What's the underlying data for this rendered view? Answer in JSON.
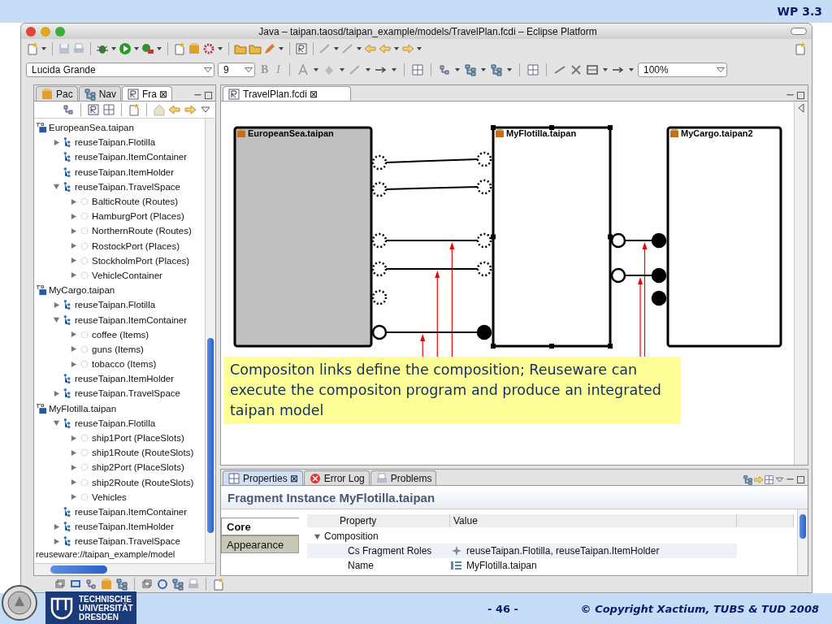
{
  "slide": {
    "section": "WP 3.3",
    "page": "- 46 -",
    "copyright": "© Copyright Xactium, TUBS & TUD 2008",
    "logo_lines": [
      "TECHNISCHE",
      "UNIVERSITÄT",
      "DRESDEN"
    ]
  },
  "window": {
    "title": "Java – taipan.taosd/taipan_example/models/TravelPlan.fcdi – Eclipse Platform"
  },
  "format_bar": {
    "font": "Lucida Grande",
    "size": "9",
    "bold": "B",
    "italic": "I",
    "zoom": "100%"
  },
  "left_panel": {
    "tabs": [
      {
        "label": "Pac",
        "selected": false
      },
      {
        "label": "Nav",
        "selected": false
      },
      {
        "label": "Fra",
        "selected": true,
        "close": "⊠"
      }
    ],
    "tree": [
      {
        "label": "EuropeanSea.taipan",
        "kind": "file",
        "children": [
          {
            "label": "reuseTaipan.Flotilla",
            "kind": "role",
            "expanded": false
          },
          {
            "label": "reuseTaipan.ItemContainer",
            "kind": "role"
          },
          {
            "label": "reuseTaipan.ItemHolder",
            "kind": "role"
          },
          {
            "label": "reuseTaipan.TravelSpace",
            "kind": "role",
            "expanded": true,
            "children": [
              {
                "label": "BalticRoute (Routes)",
                "kind": "slot",
                "expanded": false
              },
              {
                "label": "HamburgPort (Places)",
                "kind": "slot",
                "expanded": false
              },
              {
                "label": "NorthernRoute (Routes)",
                "kind": "slot",
                "expanded": false
              },
              {
                "label": "RostockPort (Places)",
                "kind": "slot",
                "expanded": false
              },
              {
                "label": "StockholmPort (Places)",
                "kind": "slot",
                "expanded": false
              },
              {
                "label": "VehicleContainer",
                "kind": "slot",
                "expanded": false
              }
            ]
          }
        ]
      },
      {
        "label": "MyCargo.taipan",
        "kind": "file",
        "children": [
          {
            "label": "reuseTaipan.Flotilla",
            "kind": "role",
            "expanded": false
          },
          {
            "label": "reuseTaipan.ItemContainer",
            "kind": "role",
            "expanded": true,
            "children": [
              {
                "label": "coffee (Items)",
                "kind": "slot",
                "expanded": false
              },
              {
                "label": "guns (Items)",
                "kind": "slot",
                "expanded": false
              },
              {
                "label": "tobacco (Items)",
                "kind": "slot",
                "expanded": false
              }
            ]
          },
          {
            "label": "reuseTaipan.ItemHolder",
            "kind": "role"
          },
          {
            "label": "reuseTaipan.TravelSpace",
            "kind": "role",
            "expanded": false
          }
        ]
      },
      {
        "label": "MyFlotilla.taipan",
        "kind": "file",
        "children": [
          {
            "label": "reuseTaipan.Flotilla",
            "kind": "role",
            "expanded": true,
            "children": [
              {
                "label": "ship1Port (PlaceSlots)",
                "kind": "slot",
                "expanded": false
              },
              {
                "label": "ship1Route (RouteSlots)",
                "kind": "slot",
                "expanded": false
              },
              {
                "label": "ship2Port (PlaceSlots)",
                "kind": "slot",
                "expanded": false
              },
              {
                "label": "ship2Route (RouteSlots)",
                "kind": "slot",
                "expanded": false
              },
              {
                "label": "Vehicles",
                "kind": "slot",
                "expanded": false
              }
            ]
          },
          {
            "label": "reuseTaipan.ItemContainer",
            "kind": "role"
          },
          {
            "label": "reuseTaipan.ItemHolder",
            "kind": "role",
            "expanded": false
          },
          {
            "label": "reuseTaipan.TravelSpace",
            "kind": "role",
            "expanded": false
          }
        ]
      }
    ],
    "path": "reuseware://taipan_example/model"
  },
  "editor": {
    "tabs": [
      {
        "label": "TravelPlan.fcdi",
        "selected": true,
        "close": "⊠"
      }
    ],
    "diagram": {
      "fragments": [
        {
          "name": "EuropeanSea.taipan",
          "color": "#c0c0c0",
          "selected": false,
          "right_ports": [
            {
              "dashed": true,
              "filled": false,
              "link": {
                "annotated": false
              }
            },
            {
              "dashed": true,
              "filled": false,
              "link": {
                "annotated": false
              }
            },
            {
              "dashed": true,
              "filled": false,
              "link": {
                "annotated": true
              }
            },
            {
              "dashed": true,
              "filled": false,
              "link": {
                "annotated": true
              }
            },
            {
              "dashed": true,
              "filled": false
            },
            {
              "dashed": false,
              "filled": false,
              "link": {
                "annotated": true
              }
            }
          ]
        },
        {
          "name": "MyFlotilla.taipan",
          "color": "#ffffff",
          "selected": true,
          "left_ports": [
            {
              "dashed": true,
              "filled": false
            },
            {
              "dashed": true,
              "filled": false
            },
            {
              "dashed": true,
              "filled": false
            },
            {
              "dashed": true,
              "filled": false
            },
            {
              "dashed": false,
              "filled": true
            }
          ],
          "right_ports": [
            {
              "dashed": false,
              "filled": false,
              "link": {
                "annotated": true
              }
            },
            {
              "dashed": false,
              "filled": false,
              "link": {
                "annotated": true
              }
            }
          ]
        },
        {
          "name": "MyCargo.taipan2",
          "color": "#ffffff",
          "selected": false,
          "left_ports": [
            {
              "dashed": false,
              "filled": true
            },
            {
              "dashed": false,
              "filled": true
            },
            {
              "dashed": false,
              "filled": true
            }
          ]
        }
      ]
    },
    "note": {
      "text": "Compositon links define the composition; Reuseware can execute the compositon program and produce an integrated taipan model"
    }
  },
  "properties": {
    "tabs": [
      {
        "label": "Properties",
        "selected": true,
        "close": "⊠"
      },
      {
        "label": "Error Log",
        "selected": false
      },
      {
        "label": "Problems",
        "selected": false
      }
    ],
    "title": "Fragment Instance MyFlotilla.taipan",
    "sections": [
      {
        "label": "Core",
        "selected": true
      },
      {
        "label": "Appearance",
        "selected": false
      }
    ],
    "columns": [
      "Property",
      "Value"
    ],
    "rows": [
      {
        "property": "Composition",
        "expanded": true,
        "children": [
          {
            "property": "Cs Fragment Roles",
            "kind": "roles",
            "value": "reuseTaipan.Flotilla, reuseTaipan.ItemHolder"
          },
          {
            "property": "Name",
            "kind": "name",
            "value": "MyFlotilla.taipan"
          }
        ]
      }
    ]
  }
}
